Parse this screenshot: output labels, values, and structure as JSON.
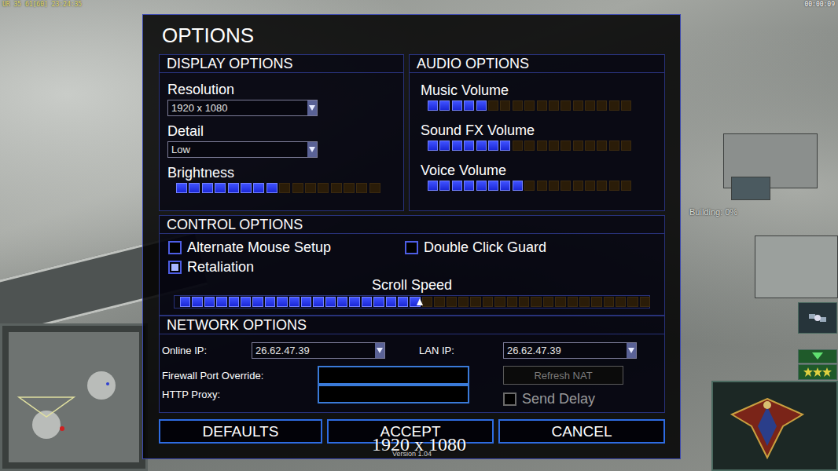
{
  "hud": {
    "debug": "UR 35 61[60] 23:24:35",
    "timer": "00:00:09",
    "status": "Building: 0%"
  },
  "dialog": {
    "title": "OPTIONS"
  },
  "display": {
    "title": "DISPLAY OPTIONS",
    "fields": [
      {
        "label": "Resolution",
        "kind": "dropdown",
        "value": "1920 x 1080"
      },
      {
        "label": "Detail",
        "kind": "dropdown",
        "value": "Low"
      },
      {
        "label": "Brightness",
        "kind": "slider",
        "level": 0.5
      }
    ]
  },
  "audio": {
    "title": "AUDIO OPTIONS",
    "sliders": [
      {
        "label": "Music Volume",
        "level": 0.29
      },
      {
        "label": "Sound FX Volume",
        "level": 0.41
      },
      {
        "label": "Voice Volume",
        "level": 0.47
      }
    ]
  },
  "controls": {
    "title": "CONTROL OPTIONS",
    "checkboxes": [
      {
        "label": "Alternate Mouse Setup",
        "checked": false
      },
      {
        "label": "Double Click Guard",
        "checked": false
      },
      {
        "label": "Retaliation",
        "checked": true
      }
    ],
    "scroll": {
      "label": "Scroll Speed",
      "level": 0.51
    }
  },
  "network": {
    "title": "NETWORK OPTIONS",
    "online_ip": {
      "label": "Online IP:",
      "value": "26.62.47.39"
    },
    "lan_ip": {
      "label": "LAN IP:",
      "value": "26.62.47.39"
    },
    "firewall": {
      "label": "Firewall Port Override:",
      "value": ""
    },
    "proxy": {
      "label": "HTTP Proxy:",
      "value": ""
    },
    "refresh": {
      "label": "Refresh NAT",
      "disabled": true
    },
    "send_delay": {
      "label": "Send Delay",
      "checked": false,
      "disabled": true
    }
  },
  "buttons": [
    {
      "label": "DEFAULTS"
    },
    {
      "label": "ACCEPT"
    },
    {
      "label": "CANCEL"
    }
  ],
  "version": "Version 1.04",
  "overlay": "1920 x 1080"
}
